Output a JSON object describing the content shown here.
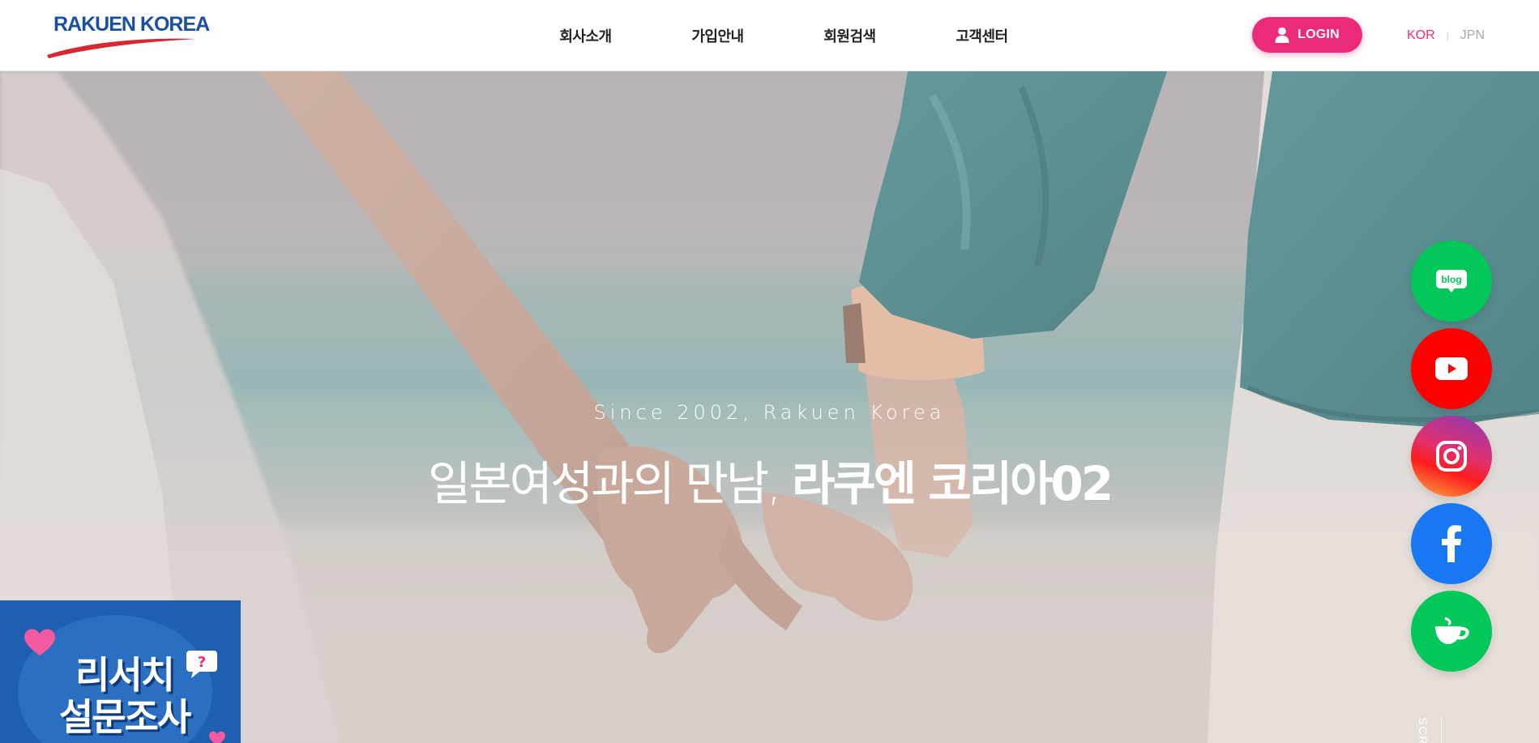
{
  "header": {
    "logo_text": "RAKUEN KOREA",
    "nav": [
      "회사소개",
      "가입안내",
      "회원검색",
      "고객센터"
    ],
    "login_label": "LOGIN",
    "lang": {
      "active": "KOR",
      "separator": "|",
      "other": "JPN"
    }
  },
  "hero": {
    "subtitle": "Since 2002, Rakuen Korea",
    "title_light": "일본여성과의 만남, ",
    "title_bold": "라쿠엔 코리아02"
  },
  "banner": {
    "line1": "리서치",
    "line2": "설문조사"
  },
  "social": [
    {
      "name": "blog",
      "icon": "blog-icon",
      "icon_text": "blog",
      "color": "#04c75a"
    },
    {
      "name": "youtube",
      "icon": "youtube-icon",
      "color": "#ff0000"
    },
    {
      "name": "instagram",
      "icon": "instagram-icon",
      "color": "#e1306c"
    },
    {
      "name": "facebook",
      "icon": "facebook-icon",
      "color": "#1877f2"
    },
    {
      "name": "cafe",
      "icon": "cafe-icon",
      "color": "#04c75a"
    }
  ],
  "scroll_label": "SCROLL",
  "colors": {
    "accent": "#ec2a7a",
    "logo_blue": "#1b4fa0",
    "banner_blue": "#1f5fb0"
  }
}
